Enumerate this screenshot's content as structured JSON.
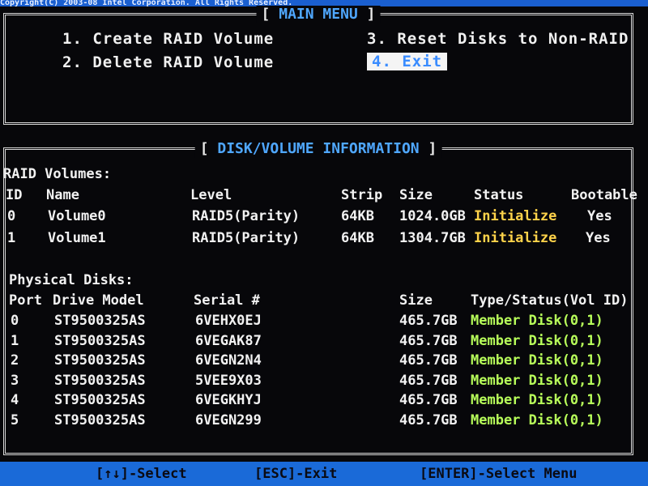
{
  "top_banner": "Copyright(C) 2003-08 Intel Corporation.  All Rights Reserved.",
  "main_menu": {
    "title": "MAIN MENU",
    "items": [
      {
        "num": "1.",
        "label": "Create RAID Volume"
      },
      {
        "num": "2.",
        "label": "Delete RAID Volume"
      },
      {
        "num": "3.",
        "label": "Reset Disks to Non-RAID"
      },
      {
        "num": "4.",
        "label": "Exit"
      }
    ]
  },
  "disk_info": {
    "title": "DISK/VOLUME INFORMATION",
    "raid_volumes_label": "RAID Volumes:",
    "volume_headers": {
      "id": "ID",
      "name": "Name",
      "level": "Level",
      "strip": "Strip",
      "size": "Size",
      "status": "Status",
      "bootable": "Bootable"
    },
    "volumes": [
      {
        "id": "0",
        "name": "Volume0",
        "level": "RAID5(Parity)",
        "strip": "64KB",
        "size": "1024.0GB",
        "status": "Initialize",
        "bootable": "Yes"
      },
      {
        "id": "1",
        "name": "Volume1",
        "level": "RAID5(Parity)",
        "strip": "64KB",
        "size": "1304.7GB",
        "status": "Initialize",
        "bootable": "Yes"
      }
    ],
    "physical_disks_label": "Physical Disks:",
    "disk_headers": {
      "port": "Port",
      "model": "Drive Model",
      "serial": "Serial #",
      "size": "Size",
      "type": "Type/Status(Vol ID)"
    },
    "disks": [
      {
        "port": "0",
        "model": "ST9500325AS",
        "serial": "6VEHX0EJ",
        "size": "465.7GB",
        "type": "Member Disk(0,1)"
      },
      {
        "port": "1",
        "model": "ST9500325AS",
        "serial": "6VEGAK87",
        "size": "465.7GB",
        "type": "Member Disk(0,1)"
      },
      {
        "port": "2",
        "model": "ST9500325AS",
        "serial": "6VEGN2N4",
        "size": "465.7GB",
        "type": "Member Disk(0,1)"
      },
      {
        "port": "3",
        "model": "ST9500325AS",
        "serial": "5VEE9X03",
        "size": "465.7GB",
        "type": "Member Disk(0,1)"
      },
      {
        "port": "4",
        "model": "ST9500325AS",
        "serial": "6VEGKHYJ",
        "size": "465.7GB",
        "type": "Member Disk(0,1)"
      },
      {
        "port": "5",
        "model": "ST9500325AS",
        "serial": "6VEGN299",
        "size": "465.7GB",
        "type": "Member Disk(0,1)"
      }
    ]
  },
  "status_bar": {
    "select": "[↑↓]-Select",
    "exit": "[ESC]-Exit",
    "enter": "[ENTER]-Select Menu"
  },
  "colors": {
    "background": "#07070a",
    "title_blue": "#4fa7ff",
    "status_yellow": "#ffd34a",
    "member_green": "#b8ff5a",
    "statusbar_blue": "#1a6ad8"
  }
}
